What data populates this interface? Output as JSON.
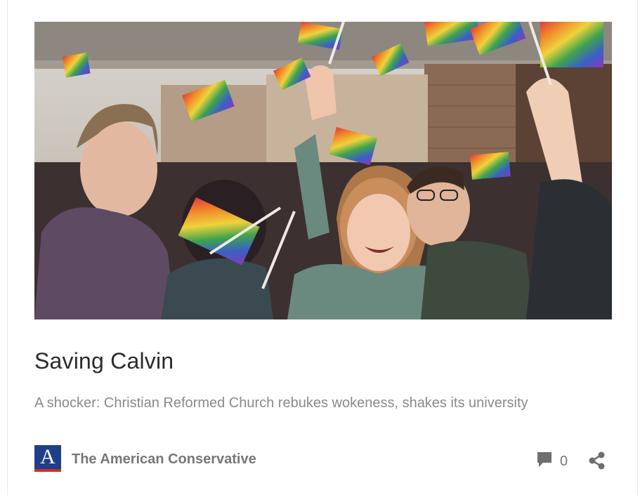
{
  "article": {
    "title": "Saving Calvin",
    "subtitle": "A shocker: Christian Reformed Church rebukes wokeness, shakes its university",
    "image_alt": "Students laughing and waving rainbow flags",
    "image_icon": "photo-students-rainbow-flags"
  },
  "footer": {
    "source_logo_letter": "A",
    "source_name": "The American Conservative",
    "comment_count": "0",
    "comment_icon": "comment-bubble-icon",
    "share_icon": "share-icon"
  },
  "colors": {
    "logo_blue": "#1e3f8a",
    "logo_red": "#d62b2b",
    "icon_gray": "#6e6e6e"
  }
}
